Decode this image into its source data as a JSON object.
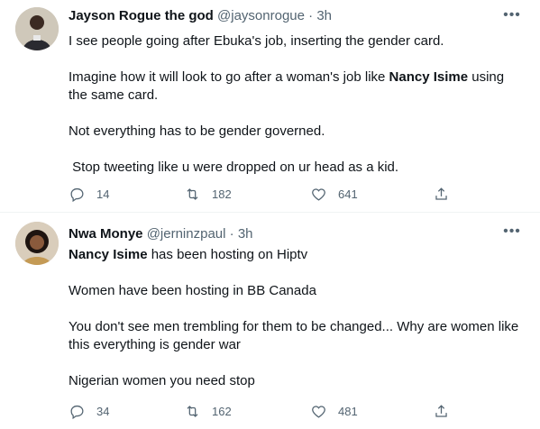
{
  "tweets": [
    {
      "display_name": "Jayson Rogue the god",
      "handle": "@jaysonrogue",
      "separator": "·",
      "time": "3h",
      "paragraphs": [
        "I see people going after Ebuka's job, inserting the gender card.",
        "Not everything has to be gender governed.",
        " Stop tweeting like u were dropped on ur head as a kid."
      ],
      "para2_pre": "Imagine how it will look to go after a woman's job like ",
      "para2_mention": "Nancy Isime",
      "para2_post": " using the same card.",
      "replies": "14",
      "retweets": "182",
      "likes": "641"
    },
    {
      "display_name": "Nwa Monye",
      "handle": "@jerninzpaul",
      "separator": "·",
      "time": "3h",
      "para1_mention": "Nancy Isime",
      "para1_post": " has been hosting on Hiptv",
      "paragraphs": [
        "Women have been hosting in BB Canada",
        "You don't see men trembling for them to be changed... Why are women like this everything is gender war",
        "Nigerian women you need stop"
      ],
      "replies": "34",
      "retweets": "162",
      "likes": "481"
    }
  ],
  "icons": {
    "more": "more-horizontal-icon",
    "reply": "reply-bubble-icon",
    "retweet": "retweet-icon",
    "like": "heart-icon",
    "share": "share-upload-icon"
  },
  "colors": {
    "text": "#0f1419",
    "secondary": "#536471",
    "divider": "#eff3f4"
  }
}
